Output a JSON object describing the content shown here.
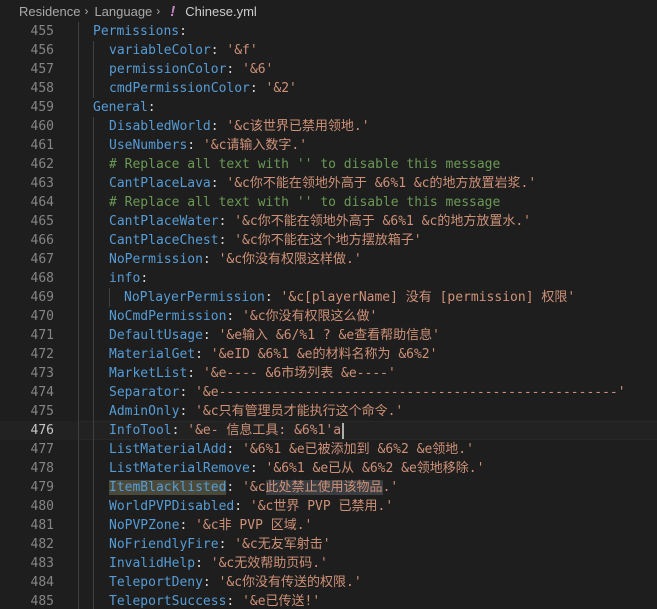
{
  "breadcrumb": {
    "parts": [
      "Residence",
      "Language"
    ],
    "separator": "›",
    "file_icon": "!",
    "file_name": "Chinese.yml"
  },
  "editor": {
    "current_line": 476,
    "lines": [
      {
        "num": "455",
        "indent": 1,
        "tokens": [
          {
            "t": "Permissions",
            "c": "k"
          },
          {
            "t": ":",
            "c": "p"
          }
        ]
      },
      {
        "num": "456",
        "indent": 2,
        "tokens": [
          {
            "t": "variableColor",
            "c": "k"
          },
          {
            "t": ": ",
            "c": "p"
          },
          {
            "t": "'&f'",
            "c": "s"
          }
        ]
      },
      {
        "num": "457",
        "indent": 2,
        "tokens": [
          {
            "t": "permissionColor",
            "c": "k"
          },
          {
            "t": ": ",
            "c": "p"
          },
          {
            "t": "'&6'",
            "c": "s"
          }
        ]
      },
      {
        "num": "458",
        "indent": 2,
        "tokens": [
          {
            "t": "cmdPermissionColor",
            "c": "k"
          },
          {
            "t": ": ",
            "c": "p"
          },
          {
            "t": "'&2'",
            "c": "s"
          }
        ]
      },
      {
        "num": "459",
        "indent": 1,
        "tokens": [
          {
            "t": "General",
            "c": "k"
          },
          {
            "t": ":",
            "c": "p"
          }
        ]
      },
      {
        "num": "460",
        "indent": 2,
        "tokens": [
          {
            "t": "DisabledWorld",
            "c": "k"
          },
          {
            "t": ": ",
            "c": "p"
          },
          {
            "t": "'&c该世界已禁用领地.'",
            "c": "s"
          }
        ]
      },
      {
        "num": "461",
        "indent": 2,
        "tokens": [
          {
            "t": "UseNumbers",
            "c": "k"
          },
          {
            "t": ": ",
            "c": "p"
          },
          {
            "t": "'&c请输入数字.'",
            "c": "s"
          }
        ]
      },
      {
        "num": "462",
        "indent": 2,
        "tokens": [
          {
            "t": "# Replace all text with '' to disable this message",
            "c": "c"
          }
        ]
      },
      {
        "num": "463",
        "indent": 2,
        "tokens": [
          {
            "t": "CantPlaceLava",
            "c": "k"
          },
          {
            "t": ": ",
            "c": "p"
          },
          {
            "t": "'&c你不能在领地外高于 &6%1 &c的地方放置岩浆.'",
            "c": "s"
          }
        ]
      },
      {
        "num": "464",
        "indent": 2,
        "tokens": [
          {
            "t": "# Replace all text with '' to disable this message",
            "c": "c"
          }
        ]
      },
      {
        "num": "465",
        "indent": 2,
        "tokens": [
          {
            "t": "CantPlaceWater",
            "c": "k"
          },
          {
            "t": ": ",
            "c": "p"
          },
          {
            "t": "'&c你不能在领地外高于 &6%1 &c的地方放置水.'",
            "c": "s"
          }
        ]
      },
      {
        "num": "466",
        "indent": 2,
        "tokens": [
          {
            "t": "CantPlaceChest",
            "c": "k"
          },
          {
            "t": ": ",
            "c": "p"
          },
          {
            "t": "'&c你不能在这个地方摆放箱子'",
            "c": "s"
          }
        ]
      },
      {
        "num": "467",
        "indent": 2,
        "tokens": [
          {
            "t": "NoPermission",
            "c": "k"
          },
          {
            "t": ": ",
            "c": "p"
          },
          {
            "t": "'&c你没有权限这样做.'",
            "c": "s"
          }
        ]
      },
      {
        "num": "468",
        "indent": 2,
        "tokens": [
          {
            "t": "info",
            "c": "k"
          },
          {
            "t": ":",
            "c": "p"
          }
        ]
      },
      {
        "num": "469",
        "indent": 3,
        "tokens": [
          {
            "t": "NoPlayerPermission",
            "c": "k"
          },
          {
            "t": ": ",
            "c": "p"
          },
          {
            "t": "'&c[playerName] 没有 [permission] 权限'",
            "c": "s"
          }
        ]
      },
      {
        "num": "470",
        "indent": 2,
        "tokens": [
          {
            "t": "NoCmdPermission",
            "c": "k"
          },
          {
            "t": ": ",
            "c": "p"
          },
          {
            "t": "'&c你没有权限这么做'",
            "c": "s"
          }
        ]
      },
      {
        "num": "471",
        "indent": 2,
        "tokens": [
          {
            "t": "DefaultUsage",
            "c": "k"
          },
          {
            "t": ": ",
            "c": "p"
          },
          {
            "t": "'&e输入 &6/%1 ? &e查看帮助信息'",
            "c": "s"
          }
        ]
      },
      {
        "num": "472",
        "indent": 2,
        "tokens": [
          {
            "t": "MaterialGet",
            "c": "k"
          },
          {
            "t": ": ",
            "c": "p"
          },
          {
            "t": "'&eID &6%1 &e的材料名称为 &6%2'",
            "c": "s"
          }
        ]
      },
      {
        "num": "473",
        "indent": 2,
        "tokens": [
          {
            "t": "MarketList",
            "c": "k"
          },
          {
            "t": ": ",
            "c": "p"
          },
          {
            "t": "'&e---- &6市场列表 &e----'",
            "c": "s"
          }
        ]
      },
      {
        "num": "474",
        "indent": 2,
        "tokens": [
          {
            "t": "Separator",
            "c": "k"
          },
          {
            "t": ": ",
            "c": "p"
          },
          {
            "t": "'&e---------------------------------------------------'",
            "c": "s"
          }
        ]
      },
      {
        "num": "475",
        "indent": 2,
        "tokens": [
          {
            "t": "AdminOnly",
            "c": "k"
          },
          {
            "t": ": ",
            "c": "p"
          },
          {
            "t": "'&c只有管理员才能执行这个命令.'",
            "c": "s"
          }
        ]
      },
      {
        "num": "476",
        "indent": 2,
        "tokens": [
          {
            "t": "InfoTool",
            "c": "k"
          },
          {
            "t": ": ",
            "c": "p"
          },
          {
            "t": "'&e- 信息工具: &6%1'a",
            "c": "s"
          }
        ]
      },
      {
        "num": "477",
        "indent": 2,
        "tokens": [
          {
            "t": "ListMaterialAdd",
            "c": "k"
          },
          {
            "t": ": ",
            "c": "p"
          },
          {
            "t": "'&6%1 &e已被添加到 &6%2 &e领地.'",
            "c": "s"
          }
        ]
      },
      {
        "num": "478",
        "indent": 2,
        "tokens": [
          {
            "t": "ListMaterialRemove",
            "c": "k"
          },
          {
            "t": ": ",
            "c": "p"
          },
          {
            "t": "'&6%1 &e已从 &6%2 &e领地移除.'",
            "c": "s"
          }
        ]
      },
      {
        "num": "479",
        "indent": 2,
        "tokens": [
          {
            "t": "ItemBlacklisted",
            "c": "k",
            "hl": "hl-key"
          },
          {
            "t": ": ",
            "c": "p"
          },
          {
            "t": "'&c",
            "c": "s"
          },
          {
            "t": "此处禁止使用该物品",
            "c": "s",
            "hl": "hl-sel"
          },
          {
            "t": ".'",
            "c": "s"
          }
        ]
      },
      {
        "num": "480",
        "indent": 2,
        "tokens": [
          {
            "t": "WorldPVPDisabled",
            "c": "k"
          },
          {
            "t": ": ",
            "c": "p"
          },
          {
            "t": "'&c世界 PVP 已禁用.'",
            "c": "s"
          }
        ]
      },
      {
        "num": "481",
        "indent": 2,
        "tokens": [
          {
            "t": "NoPVPZone",
            "c": "k"
          },
          {
            "t": ": ",
            "c": "p"
          },
          {
            "t": "'&c非 PVP 区域.'",
            "c": "s"
          }
        ]
      },
      {
        "num": "482",
        "indent": 2,
        "tokens": [
          {
            "t": "NoFriendlyFire",
            "c": "k"
          },
          {
            "t": ": ",
            "c": "p"
          },
          {
            "t": "'&c无友军射击'",
            "c": "s"
          }
        ]
      },
      {
        "num": "483",
        "indent": 2,
        "tokens": [
          {
            "t": "InvalidHelp",
            "c": "k"
          },
          {
            "t": ": ",
            "c": "p"
          },
          {
            "t": "'&c无效帮助页码.'",
            "c": "s"
          }
        ]
      },
      {
        "num": "484",
        "indent": 2,
        "tokens": [
          {
            "t": "TeleportDeny",
            "c": "k"
          },
          {
            "t": ": ",
            "c": "p"
          },
          {
            "t": "'&c你没有传送的权限.'",
            "c": "s"
          }
        ]
      },
      {
        "num": "485",
        "indent": 2,
        "tokens": [
          {
            "t": "TeleportSuccess",
            "c": "k"
          },
          {
            "t": ": ",
            "c": "p"
          },
          {
            "t": "'&e已传送!'",
            "c": "s"
          }
        ]
      }
    ]
  }
}
